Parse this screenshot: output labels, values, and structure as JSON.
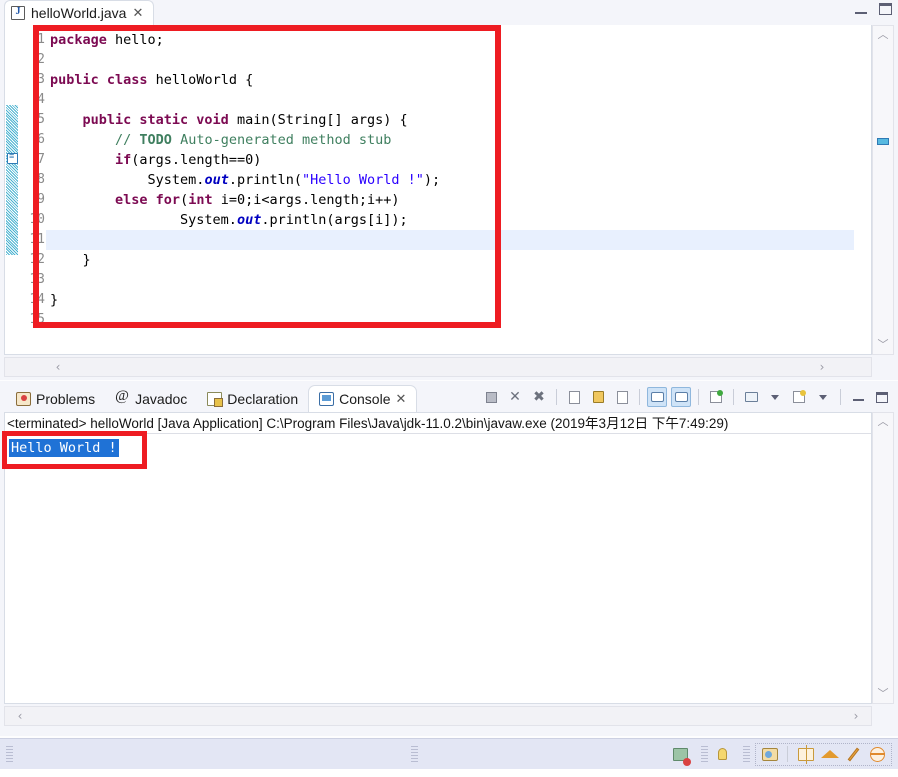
{
  "window": {
    "minimize_label": "Minimize",
    "maximize_label": "Maximize"
  },
  "editor": {
    "tab": {
      "label": "helloWorld.java",
      "icon": "java-file-icon",
      "close": "✕"
    },
    "line_numbers": [
      "1",
      "2",
      "3",
      "4",
      "5",
      "6",
      "7",
      "8",
      "9",
      "10",
      "11",
      "12",
      "13",
      "14",
      "15"
    ],
    "current_line": 11,
    "code_lines": [
      {
        "n": 1,
        "tokens": [
          {
            "t": "package",
            "c": "kw"
          },
          {
            "t": " hello;",
            "c": ""
          }
        ]
      },
      {
        "n": 2,
        "tokens": []
      },
      {
        "n": 3,
        "tokens": [
          {
            "t": "public class",
            "c": "kw"
          },
          {
            "t": " helloWorld {",
            "c": ""
          }
        ]
      },
      {
        "n": 4,
        "tokens": []
      },
      {
        "n": 5,
        "tokens": [
          {
            "t": "    ",
            "c": ""
          },
          {
            "t": "public static void",
            "c": "kw"
          },
          {
            "t": " main(String[] args) {",
            "c": ""
          }
        ]
      },
      {
        "n": 6,
        "tokens": [
          {
            "t": "        ",
            "c": ""
          },
          {
            "t": "// ",
            "c": "cmt"
          },
          {
            "t": "TODO",
            "c": "todo"
          },
          {
            "t": " Auto-generated method stub",
            "c": "cmt"
          }
        ]
      },
      {
        "n": 7,
        "tokens": [
          {
            "t": "        ",
            "c": ""
          },
          {
            "t": "if",
            "c": "kw"
          },
          {
            "t": "(args.length==0)",
            "c": ""
          }
        ]
      },
      {
        "n": 8,
        "tokens": [
          {
            "t": "            System.",
            "c": ""
          },
          {
            "t": "out",
            "c": "fld"
          },
          {
            "t": ".println(",
            "c": ""
          },
          {
            "t": "\"Hello World !\"",
            "c": "str"
          },
          {
            "t": ");",
            "c": ""
          }
        ]
      },
      {
        "n": 9,
        "tokens": [
          {
            "t": "        ",
            "c": ""
          },
          {
            "t": "else for",
            "c": "kw"
          },
          {
            "t": "(",
            "c": ""
          },
          {
            "t": "int",
            "c": "kw"
          },
          {
            "t": " i=0;i<args.length;i++)",
            "c": ""
          }
        ]
      },
      {
        "n": 10,
        "tokens": [
          {
            "t": "                System.",
            "c": ""
          },
          {
            "t": "out",
            "c": "fld"
          },
          {
            "t": ".println(args[i]);",
            "c": ""
          }
        ]
      },
      {
        "n": 11,
        "tokens": []
      },
      {
        "n": 12,
        "tokens": [
          {
            "t": "    }",
            "c": ""
          }
        ]
      },
      {
        "n": 13,
        "tokens": []
      },
      {
        "n": 14,
        "tokens": [
          {
            "t": "}",
            "c": ""
          }
        ]
      },
      {
        "n": 15,
        "tokens": []
      }
    ],
    "scrollbar": {
      "up_arrow": "︿",
      "down_arrow": "﹀",
      "left_arrow": "‹",
      "right_arrow": "›"
    }
  },
  "bottom_panel": {
    "tabs": [
      {
        "label": "Problems",
        "icon": "problems-icon",
        "active": false
      },
      {
        "label": "Javadoc",
        "icon": "javadoc-icon",
        "active": false
      },
      {
        "label": "Declaration",
        "icon": "declaration-icon",
        "active": false
      },
      {
        "label": "Console",
        "icon": "console-icon",
        "active": true,
        "close": "✕"
      }
    ],
    "toolbar": [
      {
        "name": "terminate-button",
        "icon": "stop-square-icon",
        "pressed": false
      },
      {
        "name": "remove-launch-button",
        "icon": "remove-x-icon",
        "pressed": false
      },
      {
        "name": "remove-all-terminated-button",
        "icon": "remove-all-x-icon",
        "pressed": false
      },
      {
        "name": "clear-console-button",
        "icon": "clear-console-icon",
        "pressed": false
      },
      {
        "name": "scroll-lock-button",
        "icon": "lock-icon",
        "pressed": false
      },
      {
        "name": "word-wrap-button",
        "icon": "word-wrap-icon",
        "pressed": false
      },
      {
        "name": "show-console-on-output-button",
        "icon": "console-out-icon",
        "pressed": true
      },
      {
        "name": "show-console-on-error-button",
        "icon": "console-err-icon",
        "pressed": true
      },
      {
        "name": "pin-console-button",
        "icon": "pin-icon",
        "pressed": false
      },
      {
        "name": "display-selected-console-button",
        "icon": "monitor-icon",
        "pressed": false
      },
      {
        "name": "display-selected-console-menu",
        "icon": "chevron-down-icon",
        "pressed": false
      },
      {
        "name": "open-console-button",
        "icon": "new-console-icon",
        "pressed": false
      },
      {
        "name": "open-console-menu",
        "icon": "chevron-down-icon",
        "pressed": false
      },
      {
        "name": "minimize-view-button",
        "icon": "minimize-icon",
        "pressed": false
      },
      {
        "name": "maximize-view-button",
        "icon": "maximize-icon",
        "pressed": false
      }
    ],
    "console": {
      "header": "<terminated> helloWorld [Java Application] C:\\Program Files\\Java\\jdk-11.0.2\\bin\\javaw.exe (2019年3月12日 下午7:49:29)",
      "output_selected": "Hello World !"
    }
  },
  "statusbar": {
    "icons": [
      {
        "name": "perspective-icon"
      },
      {
        "name": "bulb-icon"
      },
      {
        "name": "tip-of-the-day-icon"
      },
      {
        "name": "book-icon"
      },
      {
        "name": "graduation-hat-icon"
      },
      {
        "name": "pencil-icon"
      },
      {
        "name": "globe-icon"
      }
    ]
  },
  "annotations": {
    "color": "#ee1c22",
    "code_box": "code-highlight-box",
    "output_box": "console-output-highlight-box"
  }
}
